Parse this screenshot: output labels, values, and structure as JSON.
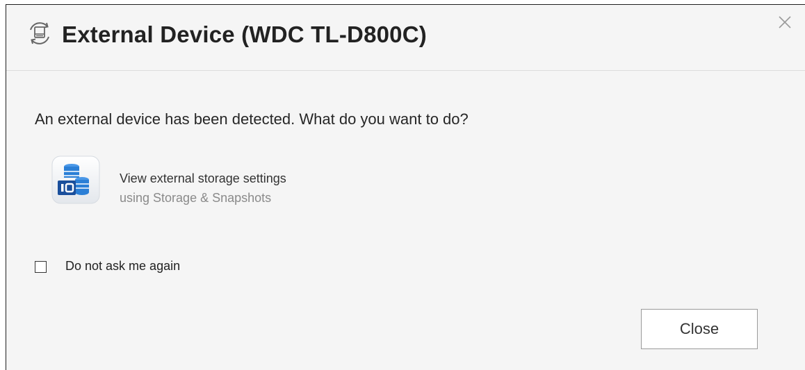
{
  "dialog": {
    "title": "External Device (WDC TL-D800C)",
    "title_icon": "external-device-icon",
    "close_icon": "close-icon"
  },
  "body": {
    "prompt": "An external device has been detected. What do you want to do?",
    "option": {
      "icon": "storage-snapshots-icon",
      "title": "View external storage settings",
      "subtitle": "using Storage & Snapshots"
    },
    "checkbox": {
      "label": "Do not ask me again",
      "checked": false
    }
  },
  "footer": {
    "close_label": "Close"
  },
  "colors": {
    "background": "#f5f5f5",
    "title_text": "#222222",
    "secondary_text": "#8a8a8a",
    "icon_blue": "#2b7fd6"
  }
}
